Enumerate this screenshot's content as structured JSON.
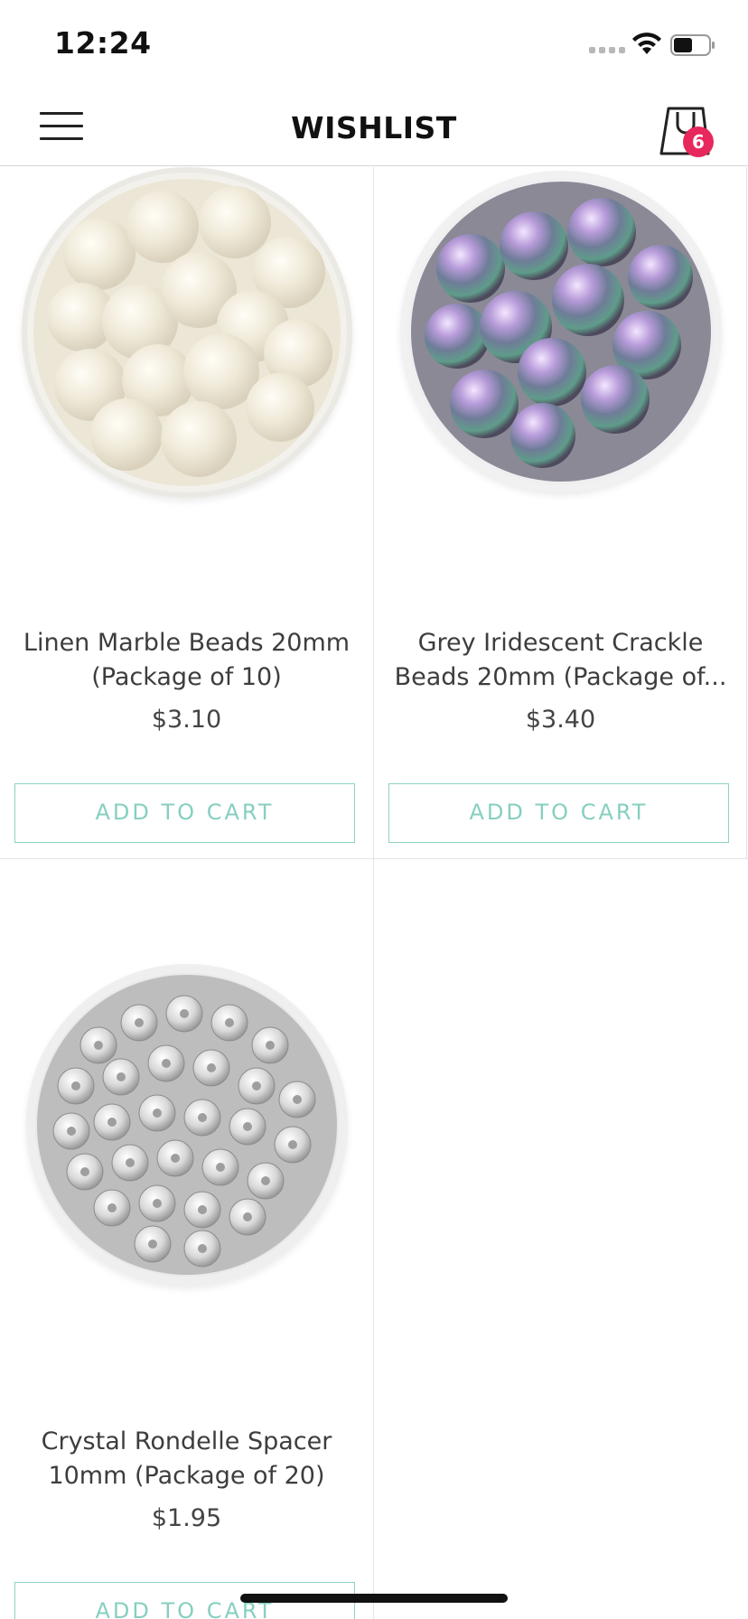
{
  "status_bar": {
    "time": "12:24"
  },
  "header": {
    "title": "WISHLIST",
    "cart_count": "6"
  },
  "products": [
    {
      "name": "Linen Marble Beads 20mm (Package of 10)",
      "price": "$3.10",
      "button": "ADD TO CART",
      "image": "linen-marble-beads-bowl"
    },
    {
      "name": "Grey Iridescent Crackle Beads 20mm (Package of...",
      "price": "$3.40",
      "button": "ADD TO CART",
      "image": "grey-iridescent-beads-bowl"
    },
    {
      "name": "Crystal Rondelle Spacer 10mm (Package of 20)",
      "price": "$1.95",
      "button": "ADD TO CART",
      "image": "crystal-rondelle-spacers-bowl"
    }
  ],
  "colors": {
    "accent": "#86cfc0",
    "badge": "#e7285c"
  }
}
